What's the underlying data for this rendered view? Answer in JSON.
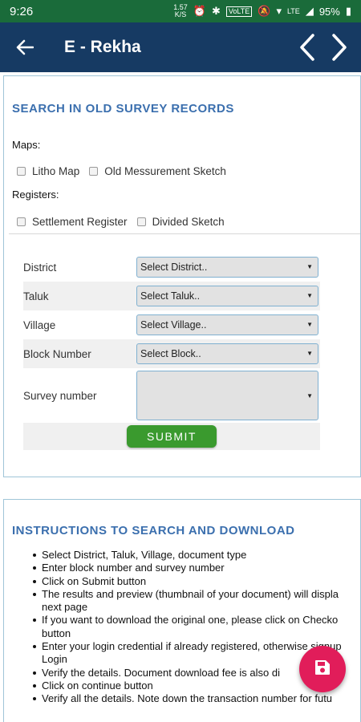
{
  "status_bar": {
    "time": "9:26",
    "speed_value": "1.57",
    "speed_unit": "K/S",
    "volte": "VoLTE",
    "lte": "LTE",
    "battery": "95%"
  },
  "app_bar": {
    "title": "E - Rekha",
    "icons": [
      "back-arrow-icon",
      "chevron-left-icon",
      "chevron-right-icon"
    ]
  },
  "search": {
    "title": "SEARCH IN OLD SURVEY RECORDS",
    "maps_label": "Maps:",
    "maps_options": [
      "Litho Map",
      "Old Messurement Sketch"
    ],
    "registers_label": "Registers:",
    "registers_options": [
      "Settlement Register",
      "Divided Sketch"
    ],
    "fields": [
      {
        "label": "District",
        "value": "Select District.."
      },
      {
        "label": "Taluk",
        "value": "Select Taluk.."
      },
      {
        "label": "Village",
        "value": "Select Village.."
      },
      {
        "label": "Block Number",
        "value": "Select Block.."
      },
      {
        "label": "Survey number",
        "value": ""
      }
    ],
    "submit_label": "SUBMIT"
  },
  "instructions": {
    "title": "INSTRUCTIONS TO SEARCH AND DOWNLOAD",
    "steps": [
      "Select District, Taluk, Village, document type",
      "Enter block number and survey number",
      "Click on Submit button",
      "The results and preview (thumbnail of your document) will displa",
      "next page",
      "If you want to download the original one, please click on Checko",
      "button",
      "Enter your login credential if already registered, otherwise signup",
      "Login",
      "Verify the details. Document download fee is also di",
      "Click on continue button",
      "Verify all the details. Note down the transaction number for futu"
    ]
  },
  "fab": {
    "icon": "save-icon"
  },
  "colors": {
    "status_bar": "#1a6b3a",
    "app_bar": "#163a63",
    "section_title": "#3b6fae",
    "submit": "#3a9a2e",
    "fab": "#e11d5a"
  }
}
